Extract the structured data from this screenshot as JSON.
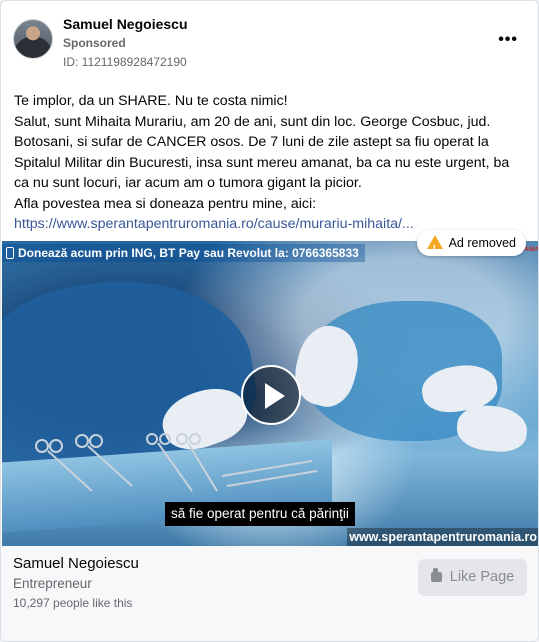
{
  "post": {
    "author": "Samuel Negoiescu",
    "sponsored_label": "Sponsored",
    "ad_id": "ID: 1121198928472190",
    "more_label": "•••",
    "body_lines": [
      "Te implor, da un SHARE. Nu te costa nimic!",
      "Salut, sunt Mihaita Murariu, am 20 de ani, sunt din loc. George Cosbuc, jud. Botosani, si sufar de CANCER osos. De 7 luni de zile astept sa fiu operat la Spitalul Militar din Bucuresti, insa sunt mereu amanat, ba ca nu este urgent, ba ca nu sunt locuri, iar acum am o tumora gigant la picior.",
      "Afla povestea mea si doneaza pentru mine, aici:"
    ],
    "link": "https://www.sperantapentruromania.ro/cause/murariu-mihaita/..."
  },
  "media": {
    "donate_banner": "Donează acum prin ING, BT Pay sau Revolut la: 0766365833",
    "corner_logo": "PENTRU ROMANIA",
    "subtitle": "să fie operat pentru că părinţii",
    "watermark": "www.sperantapentruromania.ro",
    "ad_removed": "Ad removed",
    "warning_color": "#f5a623"
  },
  "footer": {
    "page_name": "Samuel Negoiescu",
    "category": "Entrepreneur",
    "likes": "10,297 people like this",
    "like_button": "Like Page"
  },
  "colors": {
    "link": "#385898",
    "secondary_text": "#65676b",
    "button_bg": "#e4e6eb"
  }
}
